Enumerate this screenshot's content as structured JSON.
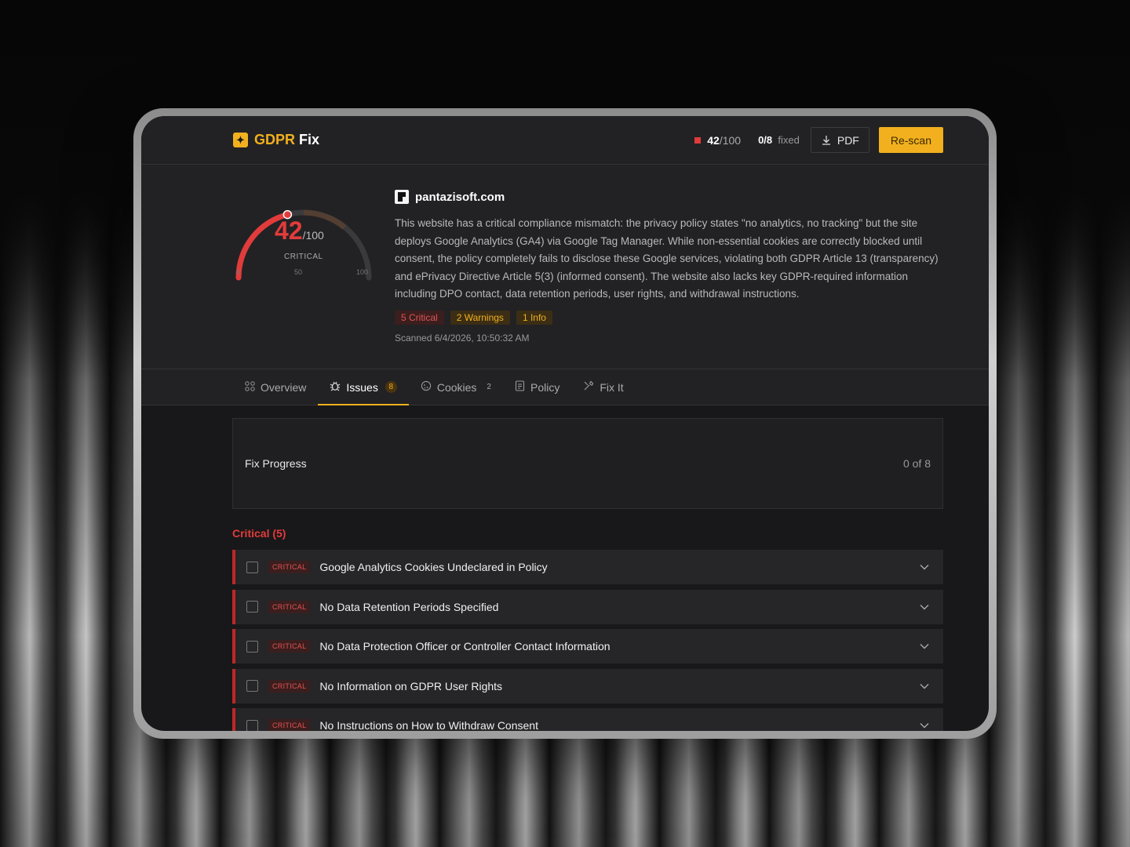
{
  "app": {
    "brand_prefix": "GDPR",
    "brand_suffix": "Fix",
    "score_value": "42",
    "score_suffix": "/100",
    "fixed_value": "0/8",
    "fixed_label": "fixed",
    "pdf_label": "PDF",
    "rescan_label": "Re-scan"
  },
  "summary": {
    "gauge_score": "42",
    "gauge_denominator": "/100",
    "gauge_level": "CRITICAL",
    "gauge_value": 42,
    "gauge_max": 100,
    "tick_min": "0",
    "tick_mid": "50",
    "tick_max": "100",
    "site": "pantazisoft.com",
    "description": "This website has a critical compliance mismatch: the privacy policy states \"no analytics, no tracking\" but the site deploys Google Analytics (GA4) via Google Tag Manager. While non-essential cookies are correctly blocked until consent, the policy completely fails to disclose these Google services, violating both GDPR Article 13 (transparency) and ePrivacy Directive Article 5(3) (informed consent). The website also lacks key GDPR-required information including DPO contact, data retention periods, user rights, and withdrawal instructions.",
    "badges": {
      "critical": "5 Critical",
      "warnings": "2 Warnings",
      "info": "1 Info"
    },
    "scanned": "Scanned 6/4/2026, 10:50:32 AM"
  },
  "tabs": {
    "overview": "Overview",
    "issues": "Issues",
    "issues_count": "8",
    "cookies": "Cookies",
    "cookies_count": "2",
    "policy": "Policy",
    "fixit": "Fix It"
  },
  "progress": {
    "title": "Fix Progress",
    "count": "0 of 8"
  },
  "critical_section": {
    "title": "Critical (5)",
    "tag": "CRITICAL",
    "items": [
      "Google Analytics Cookies Undeclared in Policy",
      "No Data Retention Periods Specified",
      "No Data Protection Officer or Controller Contact Information",
      "No Information on GDPR User Rights",
      "No Instructions on How to Withdraw Consent"
    ]
  },
  "colors": {
    "accent": "#f2b01e",
    "critical": "#e23b3b",
    "background": "#18181a"
  }
}
